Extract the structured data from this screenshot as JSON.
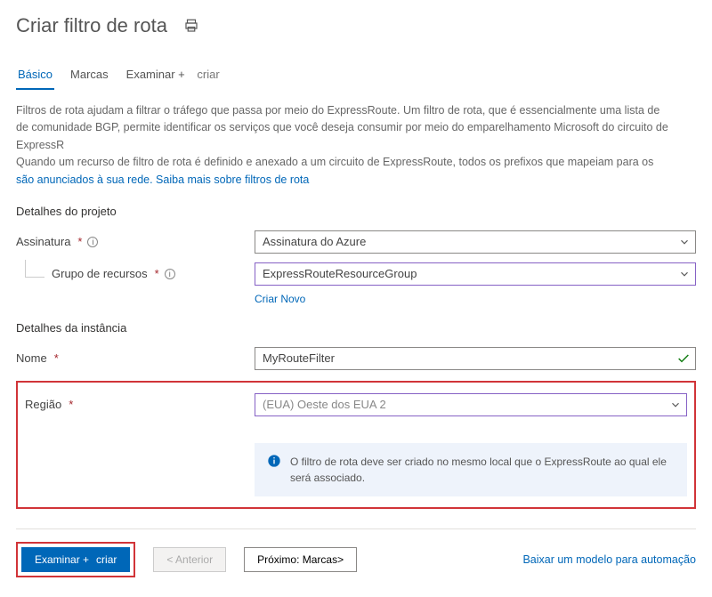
{
  "header": {
    "title": "Criar filtro de rota"
  },
  "tabs": {
    "basic": "Básico",
    "marcas": "Marcas",
    "examinar": "Examinar +",
    "criar": "criar"
  },
  "description": {
    "line1": "Filtros de rota ajudam a filtrar o tráfego que passa por meio do ExpressRoute. Um filtro de rota, que é essencialmente uma lista de",
    "line2": "de comunidade BGP, permite identificar os serviços que você deseja consumir por meio do emparelhamento Microsoft do circuito de ExpressR",
    "line3": "Quando um recurso de filtro de rota é definido e anexado a um circuito de ExpressRoute, todos os prefixos que mapeiam para os",
    "link": "são anunciados à sua rede. Saiba mais sobre filtros de rota"
  },
  "project": {
    "section": "Detalhes do projeto",
    "subscription_label": "Assinatura",
    "subscription_value": "Assinatura do Azure",
    "rg_label": "Grupo de recursos",
    "rg_value": "ExpressRouteResourceGroup",
    "create_new": "Criar Novo"
  },
  "instance": {
    "section": "Detalhes da instância",
    "name_label": "Nome",
    "name_value": "MyRouteFilter",
    "region_label": "Região",
    "region_value": "(EUA) Oeste dos EUA 2",
    "info": "O filtro de rota deve ser criado no mesmo local que o ExpressRoute ao qual ele será associado."
  },
  "footer": {
    "primary": "Examinar +",
    "primary_criar": "criar",
    "prev": "< Anterior",
    "next": "Próximo: Marcas>",
    "download": "Baixar um modelo para automação"
  }
}
